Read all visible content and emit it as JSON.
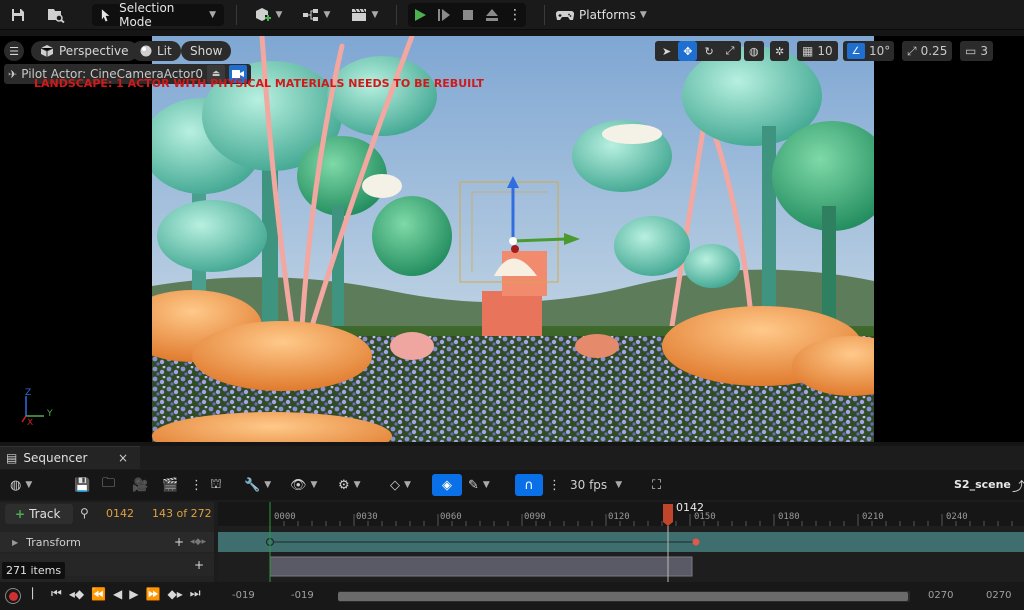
{
  "toolbar": {
    "mode_label": "Selection Mode",
    "platforms_label": "Platforms"
  },
  "viewport": {
    "perspective_label": "Perspective",
    "lit_label": "Lit",
    "show_label": "Show",
    "pilot_label": "Pilot Actor: CineCameraActor0",
    "warning": "LANDSCAPE: 1 ACTOR WITH PHYSICAL MATERIALS NEEDS TO BE REBUILT",
    "grid_size": "10",
    "angle_snap": "10°",
    "scale_snap": "0.25",
    "camera_speed": "3",
    "axis_z": "Z",
    "axis_y": "Y",
    "axis_x": "X"
  },
  "sequencer": {
    "tab_label": "Sequencer",
    "tab_close": "×",
    "fps_label": "30 fps",
    "scene_name": "S2_scene",
    "track_button": "Track",
    "current_frame": "0142",
    "frame_position": "143 of 272",
    "playhead_label": "0142",
    "ticks": [
      "0000",
      "0030",
      "0060",
      "0090",
      "0120",
      "0150",
      "0180",
      "0210",
      "0240"
    ],
    "track_name": "Transform",
    "items_count": "271 items",
    "range_start_a": "-019",
    "range_start_b": "-019",
    "range_end_a": "0270",
    "range_end_b": "0270"
  },
  "colors": {
    "accent_blue": "#0a70e8",
    "playhead": "#c0452b",
    "track_teal": "#3e6e6e",
    "warning_red": "#d01a1a"
  }
}
